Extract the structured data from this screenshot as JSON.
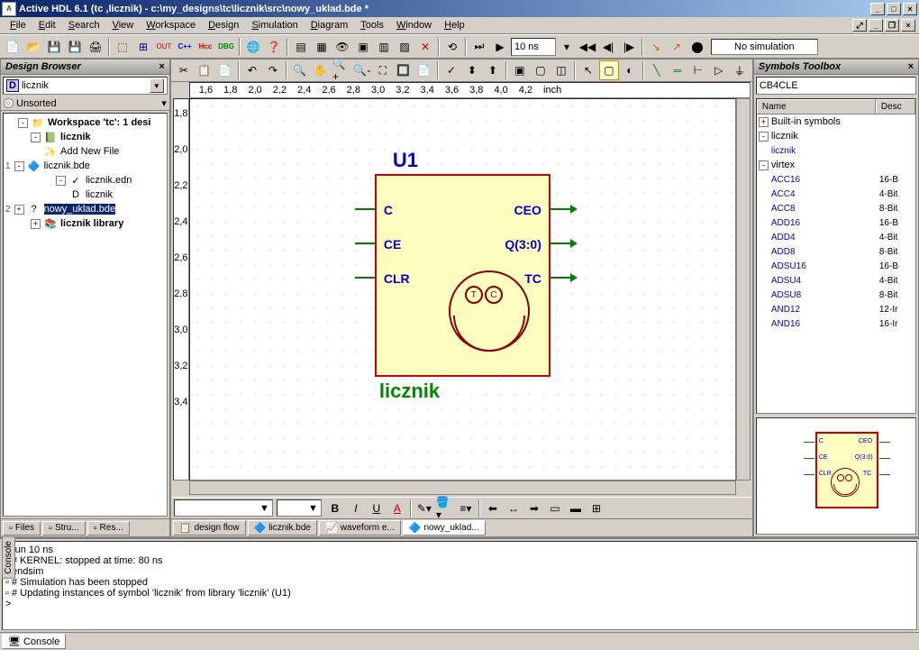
{
  "title": "Active HDL 6.1 (tc ,licznik) - c:\\my_designs\\tc\\licznik\\src\\nowy_uklad.bde *",
  "menubar": [
    "File",
    "Edit",
    "Search",
    "View",
    "Workspace",
    "Design",
    "Simulation",
    "Diagram",
    "Tools",
    "Window",
    "Help"
  ],
  "sim_time": "10 ns",
  "sim_status": "No simulation",
  "design_browser": {
    "title": "Design Browser",
    "combo_icon": "D",
    "combo_value": "licznik",
    "sort_label": "Unsorted",
    "tree": [
      {
        "level": 1,
        "exp": "-",
        "icon": "📁",
        "label": "Workspace 'tc': 1 desi",
        "bold": true
      },
      {
        "level": 2,
        "exp": "-",
        "icon": "📗",
        "label": "licznik",
        "bold": true
      },
      {
        "level": 3,
        "exp": "",
        "icon": "✨",
        "label": "Add New File"
      },
      {
        "level": 3,
        "exp": "-",
        "icon": "🔷",
        "label": "licznik.bde",
        "num": "1"
      },
      {
        "level": 4,
        "exp": "-",
        "icon": "✓",
        "label": "licznik.edn"
      },
      {
        "level": 5,
        "exp": "",
        "icon": "D",
        "label": "licznik"
      },
      {
        "level": 3,
        "exp": "+",
        "icon": "?",
        "label": "nowy_uklad.bde",
        "selected": true,
        "num": "2"
      },
      {
        "level": 2,
        "exp": "+",
        "icon": "📚",
        "label": "licznik library",
        "bold": true
      }
    ],
    "tabs": [
      "Files",
      "Stru...",
      "Res..."
    ]
  },
  "canvas": {
    "ruler_h": [
      "1,6",
      "1,8",
      "2,0",
      "2,2",
      "2,4",
      "2,6",
      "2,8",
      "3,0",
      "3,2",
      "3,4",
      "3,6",
      "3,8",
      "4,0",
      "4,2",
      "inch"
    ],
    "ruler_v": [
      "1,8",
      "2,0",
      "2,2",
      "2,4",
      "2,6",
      "2,8",
      "3,0",
      "3,2",
      "3,4"
    ],
    "symbol": {
      "instance": "U1",
      "name": "licznik",
      "pins_left": [
        "C",
        "CE",
        "CLR"
      ],
      "pins_right": [
        "CEO",
        "Q(3:0)",
        "TC"
      ],
      "fub_text": [
        "T",
        "C"
      ]
    },
    "tabs": [
      {
        "label": "design flow",
        "icon": "📋"
      },
      {
        "label": "licznik.bde",
        "icon": "🔷"
      },
      {
        "label": "waveform e...",
        "icon": "📈"
      },
      {
        "label": "nowy_uklad...",
        "icon": "🔷",
        "active": true
      }
    ],
    "format_letters": [
      "B",
      "I",
      "U",
      "A"
    ]
  },
  "symbols_toolbox": {
    "title": "Symbols Toolbox",
    "filter": "CB4CLE",
    "columns": [
      "Name",
      "Desc"
    ],
    "groups": [
      {
        "exp": "+",
        "label": "Built-in symbols"
      },
      {
        "exp": "-",
        "label": "licznik",
        "items": [
          {
            "name": "licznik",
            "desc": ""
          }
        ]
      },
      {
        "exp": "-",
        "label": "virtex",
        "items": [
          {
            "name": "ACC16",
            "desc": "16-B"
          },
          {
            "name": "ACC4",
            "desc": "4-Bit"
          },
          {
            "name": "ACC8",
            "desc": "8-Bit"
          },
          {
            "name": "ADD16",
            "desc": "16-B"
          },
          {
            "name": "ADD4",
            "desc": "4-Bit"
          },
          {
            "name": "ADD8",
            "desc": "8-Bit"
          },
          {
            "name": "ADSU16",
            "desc": "16-B"
          },
          {
            "name": "ADSU4",
            "desc": "4-Bit"
          },
          {
            "name": "ADSU8",
            "desc": "8-Bit"
          },
          {
            "name": "AND12",
            "desc": "12-Ir"
          },
          {
            "name": "AND16",
            "desc": "16-Ir"
          }
        ]
      }
    ],
    "preview_pins_left": [
      "C",
      "CE",
      "CLR"
    ],
    "preview_pins_right": [
      "CEO",
      "Q(3:0)",
      "TC"
    ]
  },
  "console": {
    "side_label": "Console",
    "lines": [
      "run 10 ns",
      "# KERNEL: stopped at time: 80 ns",
      "endsim",
      "# Simulation has been stopped",
      "# Updating instances of symbol 'licznik' from library 'licznik' (U1)",
      ">"
    ],
    "tab": "Console"
  }
}
